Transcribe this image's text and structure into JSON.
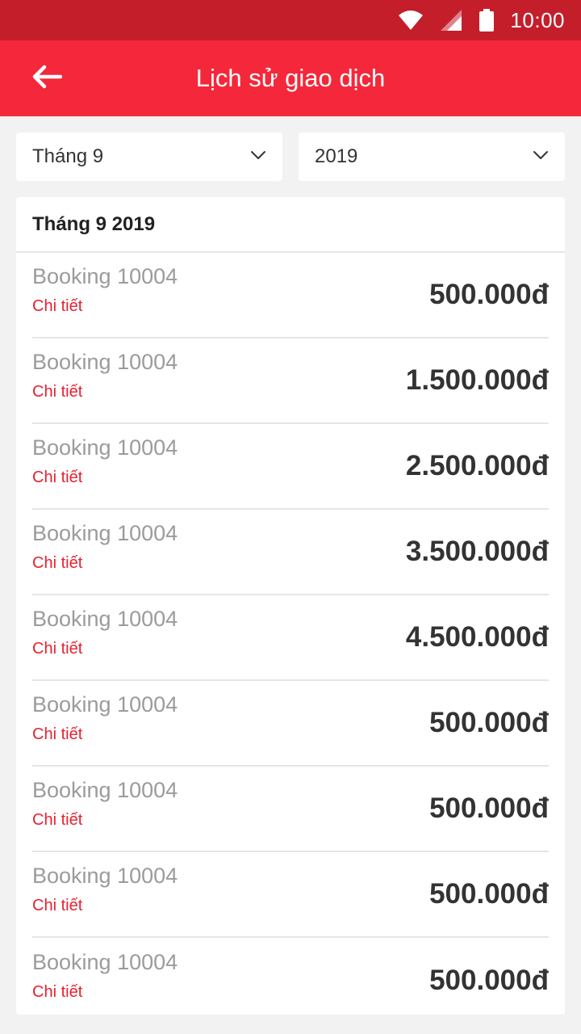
{
  "status_bar": {
    "time": "10:00",
    "icons": [
      "wifi-icon",
      "signal-icon",
      "battery-icon"
    ]
  },
  "app_bar": {
    "title": "Lịch sử giao dịch",
    "back_icon": "arrow-left-icon"
  },
  "filters": {
    "month": {
      "value": "Tháng 9",
      "icon": "chevron-down-icon"
    },
    "year": {
      "value": "2019",
      "icon": "chevron-down-icon"
    }
  },
  "section": {
    "header": "Tháng 9 2019",
    "transactions": [
      {
        "name": "Booking 10004",
        "detail_label": "Chi tiết",
        "amount": "500.000đ"
      },
      {
        "name": "Booking 10004",
        "detail_label": "Chi tiết",
        "amount": "1.500.000đ"
      },
      {
        "name": "Booking 10004",
        "detail_label": "Chi tiết",
        "amount": "2.500.000đ"
      },
      {
        "name": "Booking 10004",
        "detail_label": "Chi tiết",
        "amount": "3.500.000đ"
      },
      {
        "name": "Booking 10004",
        "detail_label": "Chi tiết",
        "amount": "4.500.000đ"
      },
      {
        "name": "Booking 10004",
        "detail_label": "Chi tiết",
        "amount": "500.000đ"
      },
      {
        "name": "Booking 10004",
        "detail_label": "Chi tiết",
        "amount": "500.000đ"
      },
      {
        "name": "Booking 10004",
        "detail_label": "Chi tiết",
        "amount": "500.000đ"
      },
      {
        "name": "Booking 10004",
        "detail_label": "Chi tiết",
        "amount": "500.000đ"
      }
    ]
  },
  "colors": {
    "status_bar": "#c41e2b",
    "app_bar": "#f5273a",
    "accent_link": "#e8202f",
    "background": "#f2f2f2"
  }
}
